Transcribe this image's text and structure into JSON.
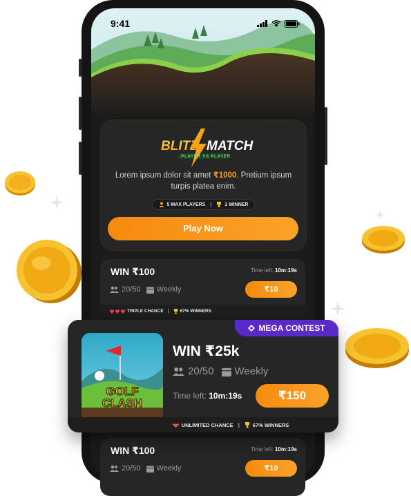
{
  "status_bar": {
    "time": "9:41"
  },
  "blitz": {
    "logo_left": "BLITZ",
    "logo_right": "MATCH",
    "subtitle": "PLAYER VS PLAYER",
    "desc_before": "Lorem ipsum dolor sit amet ",
    "desc_highlight": "₹1000",
    "desc_after": ". Pretium ipsum turpis platea enim.",
    "chip_players": "5 MAX PLAYERS",
    "chip_winner": "1 WINNER",
    "play_label": "Play Now"
  },
  "contest_1": {
    "title": "WIN ₹100",
    "time_label": "Time left:",
    "time_value": "10m:19s",
    "participants": "20/50",
    "frequency": "Weekly",
    "fee": "₹10",
    "chance": "TRIPLE CHANCE",
    "winners": "67% WINNERS"
  },
  "mega": {
    "badge": "MEGA CONTEST",
    "game_name_1": "GOLF",
    "game_name_2": "CLASH",
    "title": "WIN ₹25k",
    "participants": "20/50",
    "frequency": "Weekly",
    "time_label": "Time left:",
    "time_value": "10m:19s",
    "fee": "₹150",
    "chance": "UNLIMITED CHANCE",
    "winners": "67% WINNERS"
  },
  "contest_2": {
    "title": "WIN ₹100",
    "time_label": "Time left:",
    "time_value": "10m:19s",
    "participants": "20/50",
    "frequency": "Weekly",
    "fee": "₹10"
  },
  "colors": {
    "accent_orange": "#f58b0f",
    "mega_purple": "#5a29c9",
    "card_bg": "#262626",
    "screen_bg": "#1b1b1b"
  },
  "icons": [
    "signal-icon",
    "wifi-icon",
    "battery-icon",
    "lightning-icon",
    "players-icon",
    "trophy-icon",
    "users-icon",
    "calendar-icon",
    "heart-icon",
    "diamond-icon",
    "coin-icon",
    "sparkle-icon",
    "golf-flag-icon"
  ]
}
